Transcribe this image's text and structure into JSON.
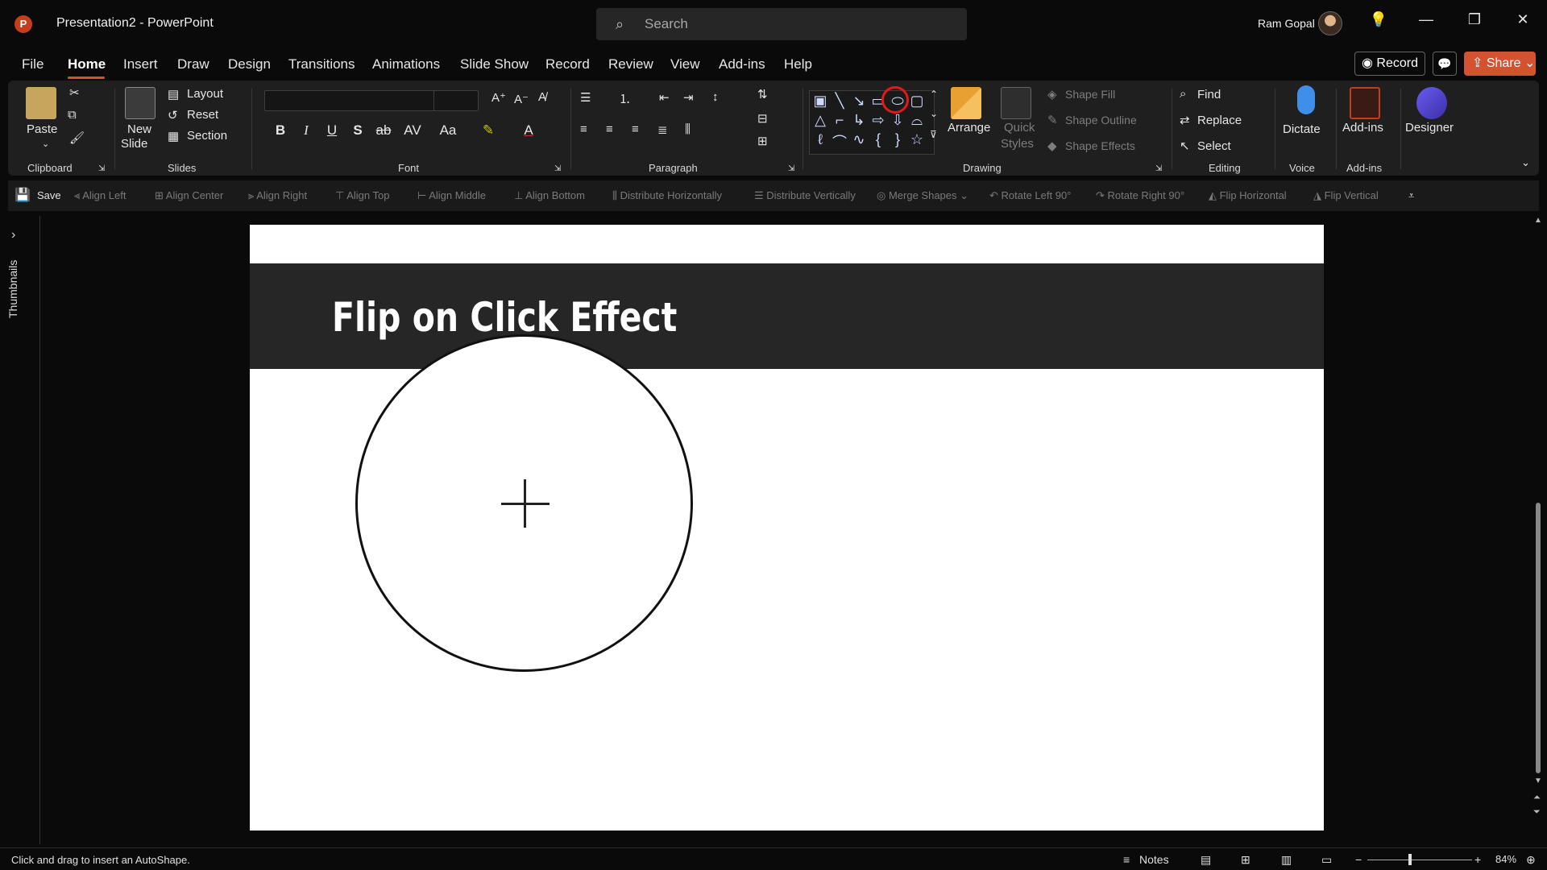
{
  "titlebar": {
    "app_initial": "P",
    "title": "Presentation2  -  PowerPoint",
    "search_placeholder": "Search",
    "user_name": "Ram Gopal"
  },
  "menu": {
    "tabs": [
      "File",
      "Home",
      "Insert",
      "Draw",
      "Design",
      "Transitions",
      "Animations",
      "Slide Show",
      "Record",
      "Review",
      "View",
      "Add-ins",
      "Help"
    ],
    "active_tab": "Home",
    "record_label": "Record",
    "share_label": "Share"
  },
  "ribbon": {
    "clipboard": {
      "label": "Clipboard",
      "paste": "Paste"
    },
    "slides": {
      "label": "Slides",
      "new_slide": "New",
      "new_slide_2": "Slide",
      "layout": "Layout",
      "reset": "Reset",
      "section": "Section"
    },
    "font": {
      "label": "Font"
    },
    "paragraph": {
      "label": "Paragraph"
    },
    "drawing": {
      "label": "Drawing",
      "arrange": "Arrange",
      "quick_styles": "Quick",
      "quick_styles_2": "Styles",
      "shape_fill": "Shape Fill",
      "shape_outline": "Shape Outline",
      "shape_effects": "Shape Effects"
    },
    "editing": {
      "label": "Editing",
      "find": "Find",
      "replace": "Replace",
      "select": "Select"
    },
    "voice": {
      "label": "Voice",
      "dictate": "Dictate"
    },
    "addins": {
      "label": "Add-ins",
      "addins_btn": "Add-ins"
    },
    "designer": "Designer"
  },
  "qat": {
    "save": "Save",
    "items": [
      "Align Left",
      "Align Center",
      "Align Right",
      "Align Top",
      "Align Middle",
      "Align Bottom",
      "Distribute Horizontally",
      "Distribute Vertically",
      "Merge Shapes",
      "Rotate Left 90°",
      "Rotate Right 90°",
      "Flip Horizontal",
      "Flip Vertical"
    ]
  },
  "pane": {
    "thumbnails": "Thumbnails"
  },
  "slide": {
    "title": "Flip on Click Effect"
  },
  "status": {
    "message": "Click and drag to insert an AutoShape.",
    "notes": "Notes",
    "zoom": "84%"
  },
  "colors": {
    "accent": "#d35230",
    "highlight_ring": "#e01a1a",
    "title_band": "#262626"
  }
}
